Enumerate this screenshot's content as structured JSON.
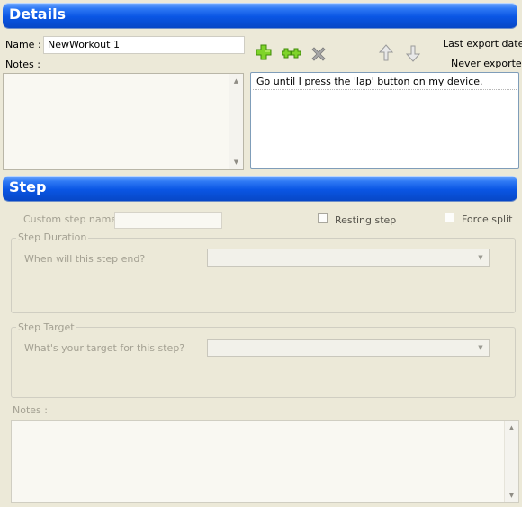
{
  "details": {
    "header": "Details",
    "name_label": "Name :",
    "name_value": "NewWorkout 1",
    "notes_label": "Notes :",
    "last_export_label": "Last export date :",
    "last_export_value": "Never exported",
    "toolbar": {
      "add_icon": "add-icon",
      "add_repeat_icon": "add-repeat-icon",
      "delete_icon": "delete-icon",
      "move_up_icon": "arrow-up-icon",
      "move_down_icon": "arrow-down-icon"
    },
    "steps": [
      {
        "text": "Go until I press the 'lap' button on my device."
      }
    ]
  },
  "step": {
    "header": "Step",
    "custom_name_label": "Custom step name:",
    "custom_name_value": "",
    "resting_label": "Resting step",
    "force_split_label": "Force split",
    "duration": {
      "title": "Step Duration",
      "question": "When will this step end?",
      "selected": ""
    },
    "target": {
      "title": "Step Target",
      "question": "What's your target for this step?",
      "selected": ""
    },
    "notes_label": "Notes :"
  },
  "colors": {
    "header_blue": "#0a56e4",
    "background": "#ece9d8",
    "disabled_text": "#a3a092",
    "add_green": "#6ccb1e",
    "delete_gray": "#8a8a8a"
  }
}
